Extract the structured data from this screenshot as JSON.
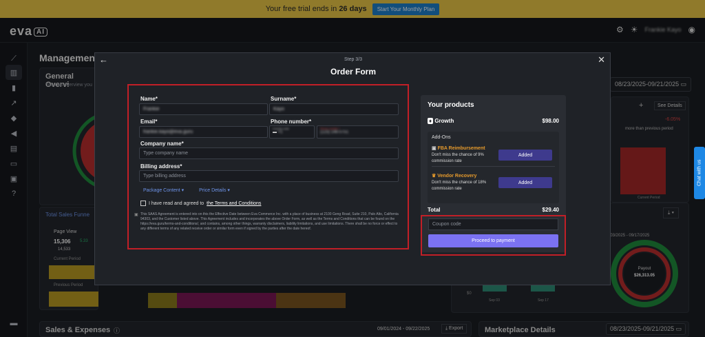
{
  "banner": {
    "text": "Your free trial ends in",
    "days": "26 days",
    "cta": "Start Your Monthly Plan"
  },
  "header": {
    "logo": "eva",
    "logo_badge": "AI",
    "user_name": "Frankie Kayo"
  },
  "nav": {
    "icons": [
      "line-chart-icon",
      "bar-chart-icon",
      "bar-chart-2-icon",
      "trend-icon",
      "tag-icon",
      "megaphone-icon",
      "clipboard-icon",
      "archive-icon",
      "bot-icon",
      "help-icon",
      "flag-us-icon"
    ]
  },
  "dashboard": {
    "title": "Management",
    "general_overview": {
      "title": "General Overvi",
      "subtitle": "You can overview you"
    },
    "date_range_top": "08/23/2025-09/21/2025",
    "see_details": "See Details",
    "change_pct": "-6.05%",
    "change_text": "more than previous period",
    "current_period": "Current Period",
    "funnel": {
      "tab": "Total Sales Funne",
      "metric": "Page View",
      "value": "15,306",
      "pct": "5.33",
      "prev_value": "14,533",
      "current_period": "Current Period",
      "previous_period": "Previous Period"
    },
    "payout_range": "09/03/2025 - 09/17/2025",
    "payout": {
      "label": "Payout",
      "value": "$26,313.05"
    },
    "bar_axis": {
      "zero": "$0",
      "x1": "Sep 03",
      "x2": "Sep 17"
    },
    "sales_expenses": {
      "title": "Sales & Expenses",
      "range": "09/01/2024 - 09/22/2025",
      "export": "Export"
    },
    "marketplace": {
      "title": "Marketplace Details",
      "range": "08/23/2025-09/21/2025"
    }
  },
  "modal": {
    "step": "Step 3/3",
    "title": "Order Form",
    "form": {
      "name_label": "Name*",
      "name_value": "Frankie",
      "surname_label": "Surname*",
      "surname_value": "Kayo",
      "email_label": "Email*",
      "email_value": "frankie.kayo@eva.guru",
      "phone_label": "Phone number*",
      "country_code_label": "Country code",
      "country_code_value": "+1",
      "phone_field_label": "Phone number *",
      "phone_value": "(123) 146-0751",
      "company_label": "Company name*",
      "company_placeholder": "Type company name",
      "billing_label": "Billing address*",
      "billing_placeholder": "Type billing address",
      "package_content": "Package Content",
      "price_details": "Price Details",
      "agree_text": "I have read and agreed to",
      "agree_link": "the Terms and Conditions",
      "legal": "This SAAS Agreement is entered into on this the Effective Date between Eva Commerce Inc. with a place of business at 2100 Geng Road, Suite 210, Palo Alto, California 94303, and the Customer listed above. This Agreement includes and incorporates the above Order Form, as well as the Terms and Conditions that can be found on the https://eva.guru/terms-and-conditions/, and contains, among other things, warranty disclaimers, liability limitations, and use limitations. There shall be no force or effect to any different terms of any related receive order or similar form even if signed by the parties after the date hereof."
    },
    "products": {
      "title": "Your products",
      "plan": {
        "name": "Growth",
        "price": "$98.00"
      },
      "addons_title": "Add-Ons",
      "addons": [
        {
          "name": "FBA Reimbursement",
          "desc": "Don't miss the chance of 9% commission rate",
          "button": "Added"
        },
        {
          "name": "Vendor Recovery",
          "desc": "Don't miss the chance of 18% commission rate",
          "button": "Added"
        }
      ],
      "total_label": "Total",
      "total_value": "$29.40",
      "coupon_placeholder": "Coupon code",
      "pay_button": "Proceed to payment"
    }
  },
  "chat": {
    "label": "Chat with us"
  },
  "colors": {
    "accent": "#7b72f2",
    "highlight": "#c21f27",
    "banner": "#e8c546",
    "addon": "#e59a2c"
  }
}
